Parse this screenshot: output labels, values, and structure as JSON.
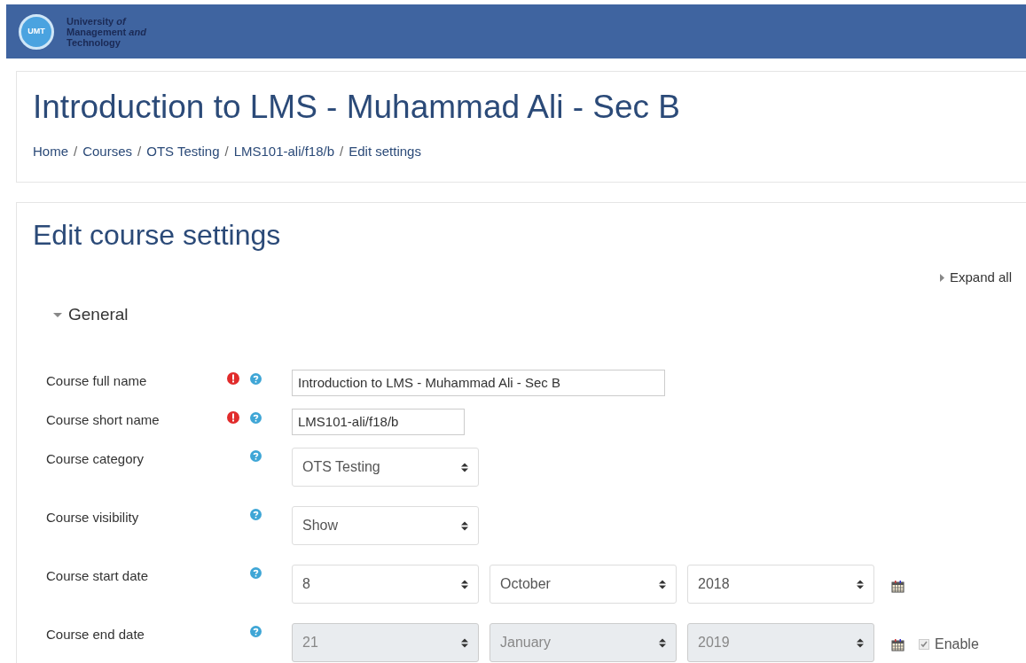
{
  "header": {
    "logo_text": "UMT",
    "name_lines": [
      "University *of*",
      "Management *and*",
      "Technology"
    ]
  },
  "page_title": "Introduction to LMS - Muhammad Ali - Sec B",
  "breadcrumbs": [
    "Home",
    "Courses",
    "OTS Testing",
    "LMS101-ali/f18/b",
    "Edit settings"
  ],
  "breadcrumb_separators": [
    "/",
    "/",
    "/",
    "/"
  ],
  "form": {
    "title": "Edit course settings",
    "expand_all": "Expand all",
    "section": {
      "title": "General",
      "expanded": true
    },
    "fields": [
      {
        "kind": "text",
        "label": "Course full name",
        "required": true,
        "value": "Introduction to LMS - Muhammad Ali - Sec B"
      },
      {
        "kind": "text",
        "label": "Course short name",
        "required": true,
        "value": "LMS101-ali/f18/b"
      },
      {
        "kind": "select",
        "label": "Course category",
        "required": false,
        "value": "OTS Testing"
      },
      {
        "kind": "select",
        "label": "Course visibility",
        "required": false,
        "value": "Show"
      },
      {
        "kind": "date",
        "label": "Course start date",
        "required": false,
        "disabled": false,
        "day": "8",
        "month": "October",
        "year": "2018"
      },
      {
        "kind": "date",
        "label": "Course end date",
        "required": false,
        "disabled": true,
        "day": "21",
        "month": "January",
        "year": "2019",
        "enable": {
          "label": "Enable",
          "checked": true
        }
      }
    ]
  }
}
